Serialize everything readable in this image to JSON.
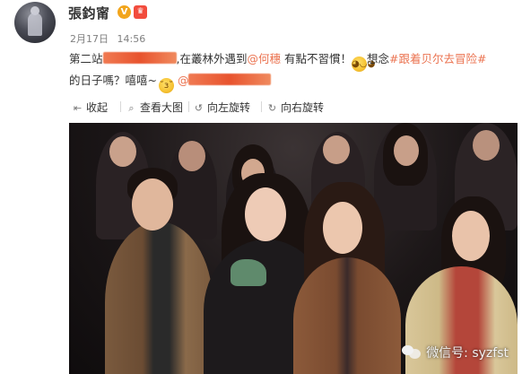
{
  "header": {
    "username": "張鈞甯",
    "verified_mark": "V",
    "vip_mark": "♛",
    "date": "2月17日",
    "time": "14:56"
  },
  "post": {
    "line1": {
      "prefix": "第二站",
      "middle": ",在叢林外遇到",
      "mention": "@何穗",
      "after_mention": " 有點不習慣！",
      "emoji": "😁",
      "think": "想念",
      "topic": "#跟着贝尔去冒险#"
    },
    "line2": {
      "text": "的日子嗎？嘻嘻~",
      "emoji": "😙",
      "at_prefix": "@"
    }
  },
  "toolbar": {
    "collapse": "收起",
    "view_large": "查看大图",
    "rotate_left": "向左旋转",
    "rotate_right": "向右旋转"
  },
  "watermark": {
    "text": "微信号: syzfst"
  },
  "colors": {
    "link": "#eb7350",
    "verified": "#f2a51c",
    "meta": "#808080"
  },
  "icons": [
    "collapse-icon",
    "magnifier-icon",
    "rotate-left-icon",
    "rotate-right-icon",
    "wechat-icon"
  ]
}
